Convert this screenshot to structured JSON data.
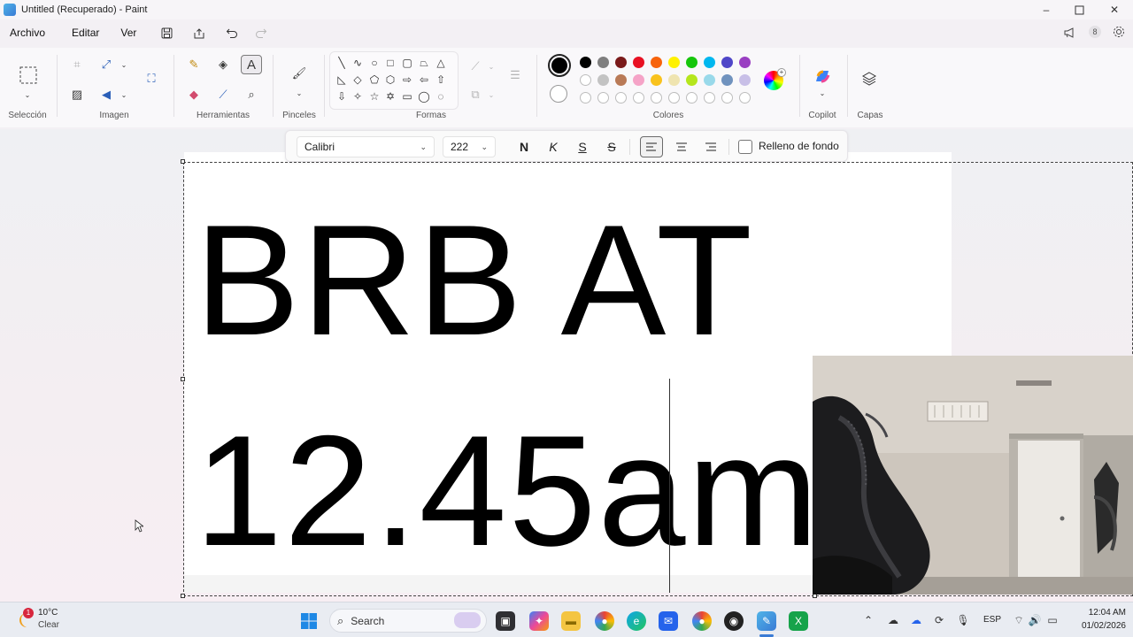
{
  "window": {
    "title": "Untitled (Recuperado) - Paint",
    "minimize": "–",
    "maximize": "▢",
    "close": "✕"
  },
  "menubar": {
    "items": [
      "Archivo",
      "Editar",
      "Ver"
    ],
    "quick_access": [
      "save-icon",
      "share-icon",
      "undo-icon",
      "redo-icon"
    ],
    "notification_badge": "8"
  },
  "ribbon": {
    "groups": {
      "seleccion": "Selección",
      "imagen": "Imagen",
      "herramientas": "Herramientas",
      "pinceles": "Pinceles",
      "formas": "Formas",
      "colores": "Colores",
      "copilot": "Copilot",
      "capas": "Capas"
    },
    "active_tool": "text-tool",
    "colors": {
      "primary": "#000000",
      "secondary": "#ffffff",
      "row1": [
        "#000000",
        "#7f7f7f",
        "#7a1a1a",
        "#e81123",
        "#f7630c",
        "#fff100",
        "#16c60c",
        "#00b7ef",
        "#4f46c8",
        "#9a3fc2"
      ],
      "row2": [
        "#ffffff",
        "#c3c3c3",
        "#b97a57",
        "#f5a3c7",
        "#f9c21d",
        "#efe4b0",
        "#b5e61d",
        "#99d9ea",
        "#7092be",
        "#c8bfe7"
      ]
    }
  },
  "formatbar": {
    "font": "Calibri",
    "size": "222",
    "bold": "N",
    "italic": "K",
    "underline": "S",
    "strike": "S",
    "background_fill_label": "Relleno de fondo",
    "alignment": "left"
  },
  "canvas": {
    "line1": "BRB AT",
    "line2": "12.45am"
  },
  "taskbar": {
    "weather_temp": "10°C",
    "weather_desc": "Clear",
    "weather_badge": "1",
    "search_placeholder": "Search",
    "language": "ESP",
    "time": "12:04 AM",
    "date": "01/02/2026"
  }
}
